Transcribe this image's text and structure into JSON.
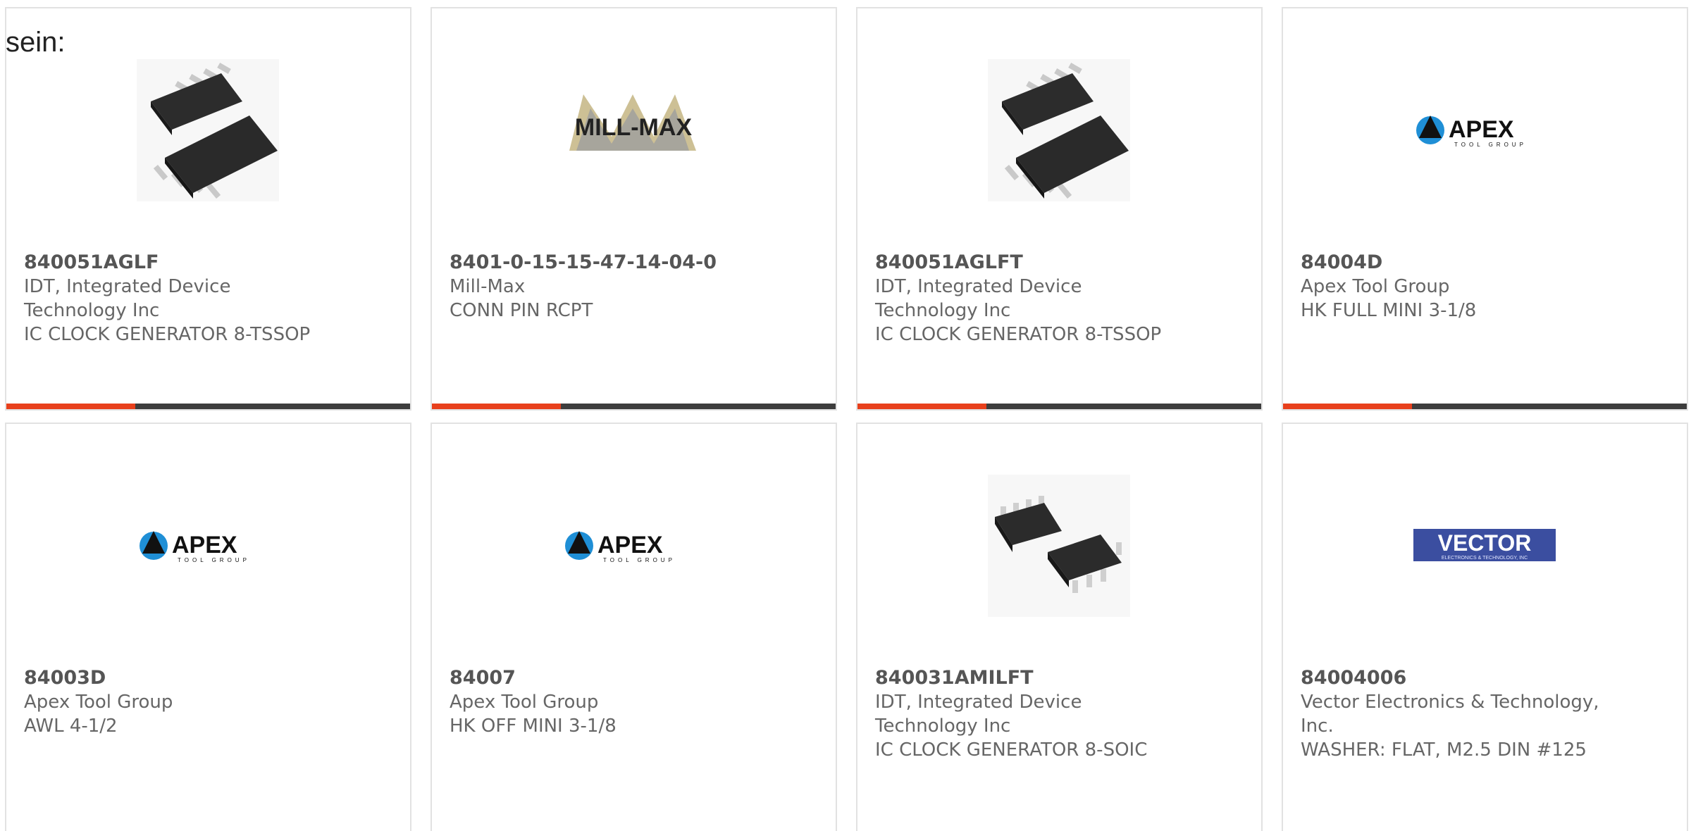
{
  "intro_text": "sein:",
  "colors": {
    "accent": "#e8401c",
    "bar": "#3d3d3d",
    "border": "#e2e2e2",
    "text": "#666666"
  },
  "products": [
    {
      "part": "840051AGLF",
      "maker": "IDT, Integrated Device Technology Inc",
      "desc": "IC CLOCK GENERATOR 8-TSSOP",
      "image": "tssop-chip-icon"
    },
    {
      "part": "8401-0-15-15-47-14-04-0",
      "maker": "Mill-Max",
      "desc": "CONN PIN RCPT",
      "image": "mill-max-logo",
      "logo_text": "MILL-MAX"
    },
    {
      "part": "840051AGLFT",
      "maker": "IDT, Integrated Device Technology Inc",
      "desc": "IC CLOCK GENERATOR 8-TSSOP",
      "image": "tssop-chip-icon"
    },
    {
      "part": "84004D",
      "maker": "Apex Tool Group",
      "desc": "HK FULL MINI 3-1/8",
      "image": "apex-logo",
      "logo_text": "APEX",
      "logo_sub": "TOOL GROUP"
    },
    {
      "part": "84003D",
      "maker": "Apex Tool Group",
      "desc": "AWL 4-1/2",
      "image": "apex-logo",
      "logo_text": "APEX",
      "logo_sub": "TOOL GROUP"
    },
    {
      "part": "84007",
      "maker": "Apex Tool Group",
      "desc": "HK OFF MINI 3-1/8",
      "image": "apex-logo",
      "logo_text": "APEX",
      "logo_sub": "TOOL GROUP"
    },
    {
      "part": "840031AMILFT",
      "maker": "IDT, Integrated Device Technology Inc",
      "desc": "IC CLOCK GENERATOR 8-SOIC",
      "image": "soic-chip-icon"
    },
    {
      "part": "84004006",
      "maker": "Vector Electronics & Technology, Inc.",
      "desc": "WASHER: FLAT, M2.5 DIN #125",
      "image": "vector-logo",
      "logo_text": "VECTOR",
      "logo_sub": "ELECTRONICS & TECHNOLOGY, INC"
    }
  ]
}
